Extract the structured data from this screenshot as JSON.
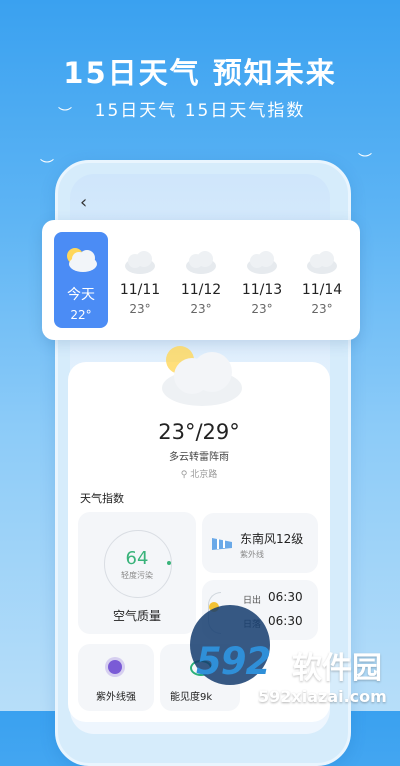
{
  "promo": {
    "headline": "15日天气  预知未来",
    "subline": "15日天气  15日天气指数"
  },
  "nav": {
    "back_icon": "chevron-left-icon"
  },
  "forecast": [
    {
      "name": "今天",
      "temp": "22°",
      "icon": "partly-cloudy-icon"
    },
    {
      "name": "11/11",
      "temp": "23°",
      "icon": "cloud-icon"
    },
    {
      "name": "11/12",
      "temp": "23°",
      "icon": "cloud-icon"
    },
    {
      "name": "11/13",
      "temp": "23°",
      "icon": "cloud-icon"
    },
    {
      "name": "11/14",
      "temp": "23°",
      "icon": "cloud-icon"
    }
  ],
  "current": {
    "temp_range": "23°/29°",
    "condition": "多云转雷阵雨",
    "location": "北京路"
  },
  "indices": {
    "title": "天气指数",
    "aqi": {
      "value": "64",
      "level": "轻度污染",
      "label": "空气质量"
    },
    "wind": {
      "main": "东南风12级",
      "sub": "紫外线"
    },
    "sun": {
      "sunrise_label": "日出",
      "sunrise": "06:30",
      "sunset_label": "日落",
      "sunset": "06:30"
    },
    "uv": {
      "label": "紫外线强"
    },
    "visibility": {
      "label": "能见度9k"
    }
  },
  "watermark": {
    "number": "592",
    "text": "软件园",
    "url": "592xiazai.com"
  },
  "colors": {
    "today_bg": "#4b8cf5",
    "aqi_green": "#39b37a",
    "bg_top": "#3aa1f0"
  }
}
